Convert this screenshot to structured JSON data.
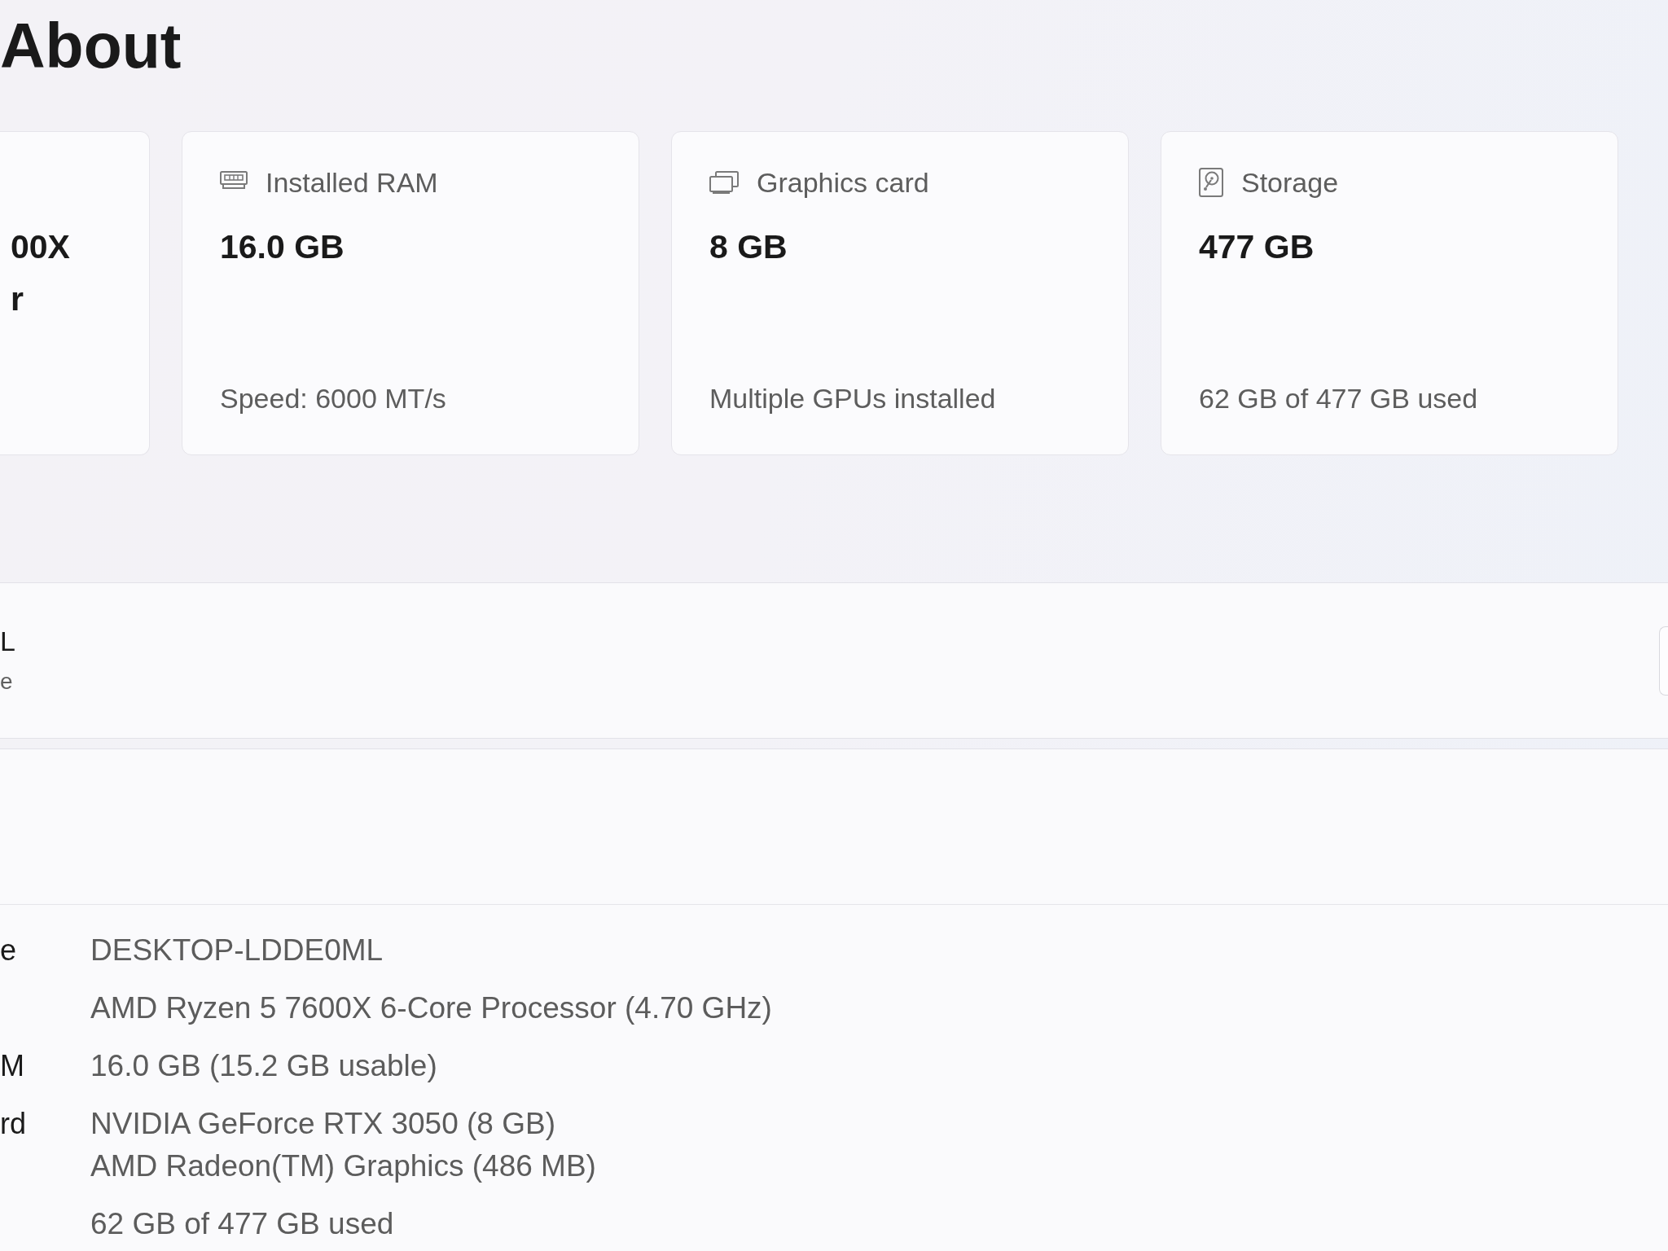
{
  "page": {
    "title": "About"
  },
  "spec_cards": [
    {
      "kind": "partial",
      "value_lines": [
        "00X",
        "r"
      ]
    },
    {
      "kind": "ram",
      "label": "Installed RAM",
      "value_lines": [
        "16.0 GB"
      ],
      "detail": "Speed: 6000 MT/s"
    },
    {
      "kind": "gpu",
      "label": "Graphics card",
      "value_lines": [
        "8 GB"
      ],
      "detail": "Multiple GPUs installed"
    },
    {
      "kind": "storage",
      "label": "Storage",
      "value_lines": [
        "477 GB"
      ],
      "detail": "62 GB of 477 GB used"
    }
  ],
  "device_header": {
    "name": "L",
    "subtitle": "e",
    "cut_button": true
  },
  "device_specifications": {
    "rows": [
      {
        "label": "e",
        "values": [
          "DESKTOP-LDDE0ML"
        ]
      },
      {
        "values": [
          "AMD Ryzen 5 7600X 6-Core Processor (4.70 GHz)"
        ]
      },
      {
        "label": "M",
        "values": [
          "16.0 GB (15.2 GB usable)"
        ]
      },
      {
        "label": "rd",
        "values": [
          "NVIDIA GeForce RTX 3050 (8 GB)",
          "AMD Radeon(TM) Graphics (486 MB)"
        ]
      },
      {
        "values": [
          "62 GB of 477 GB used"
        ]
      }
    ]
  }
}
